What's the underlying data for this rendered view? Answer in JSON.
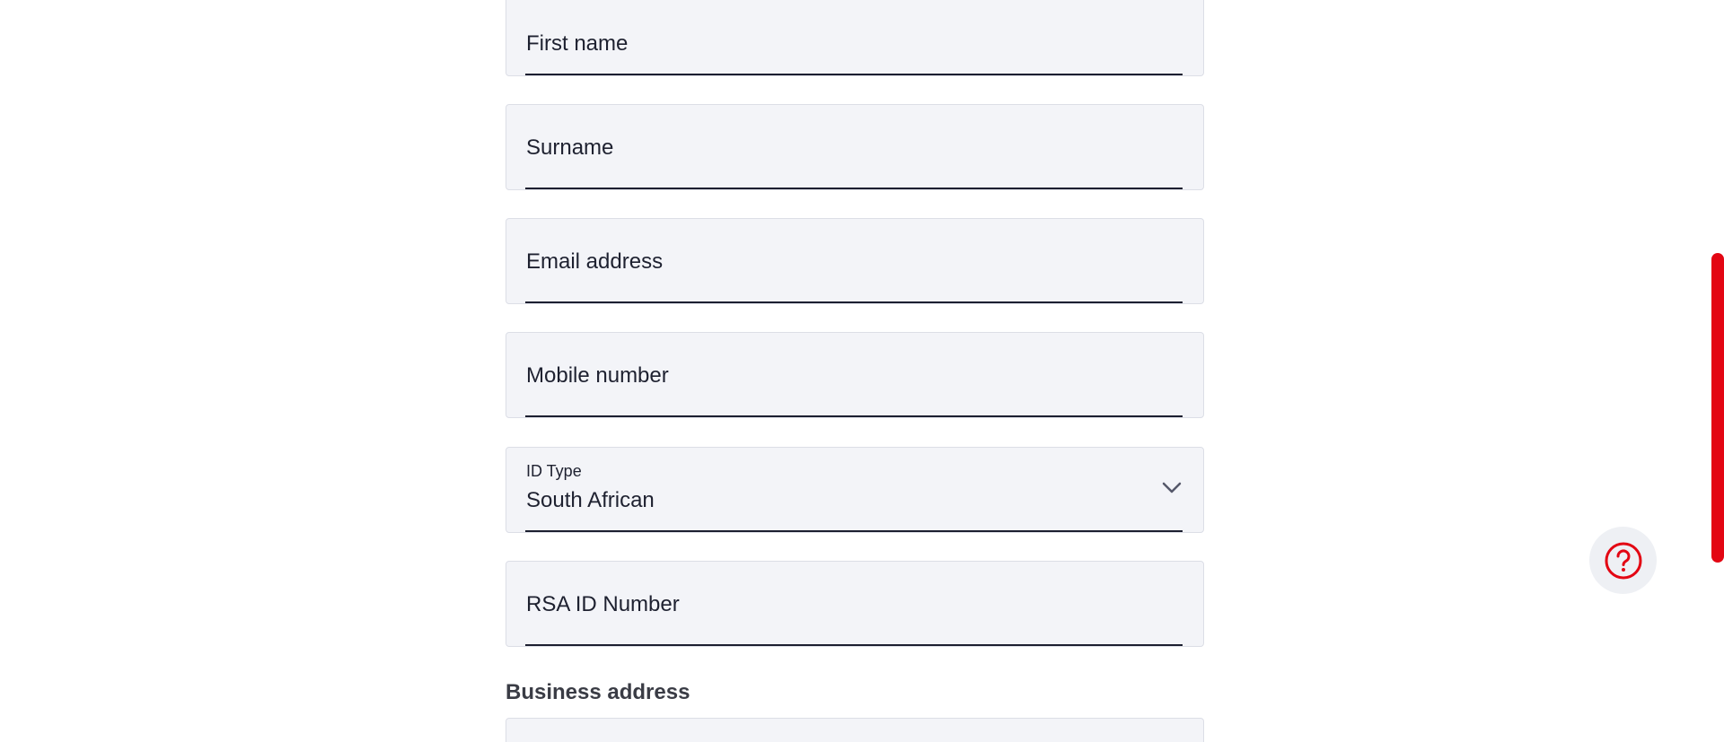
{
  "form": {
    "fields": [
      {
        "label": "First name"
      },
      {
        "label": "Surname"
      },
      {
        "label": "Email address"
      },
      {
        "label": "Mobile number"
      },
      {
        "label": "ID Type",
        "value": "South African",
        "icon": "chevron-down-icon"
      },
      {
        "label": "RSA ID Number"
      }
    ],
    "business_address_title": "Business address"
  },
  "help": {
    "icon": "help-question-icon"
  },
  "colors": {
    "field_bg": "#f3f4f8",
    "underline": "#1c1f30",
    "accent_red": "#e30613"
  }
}
